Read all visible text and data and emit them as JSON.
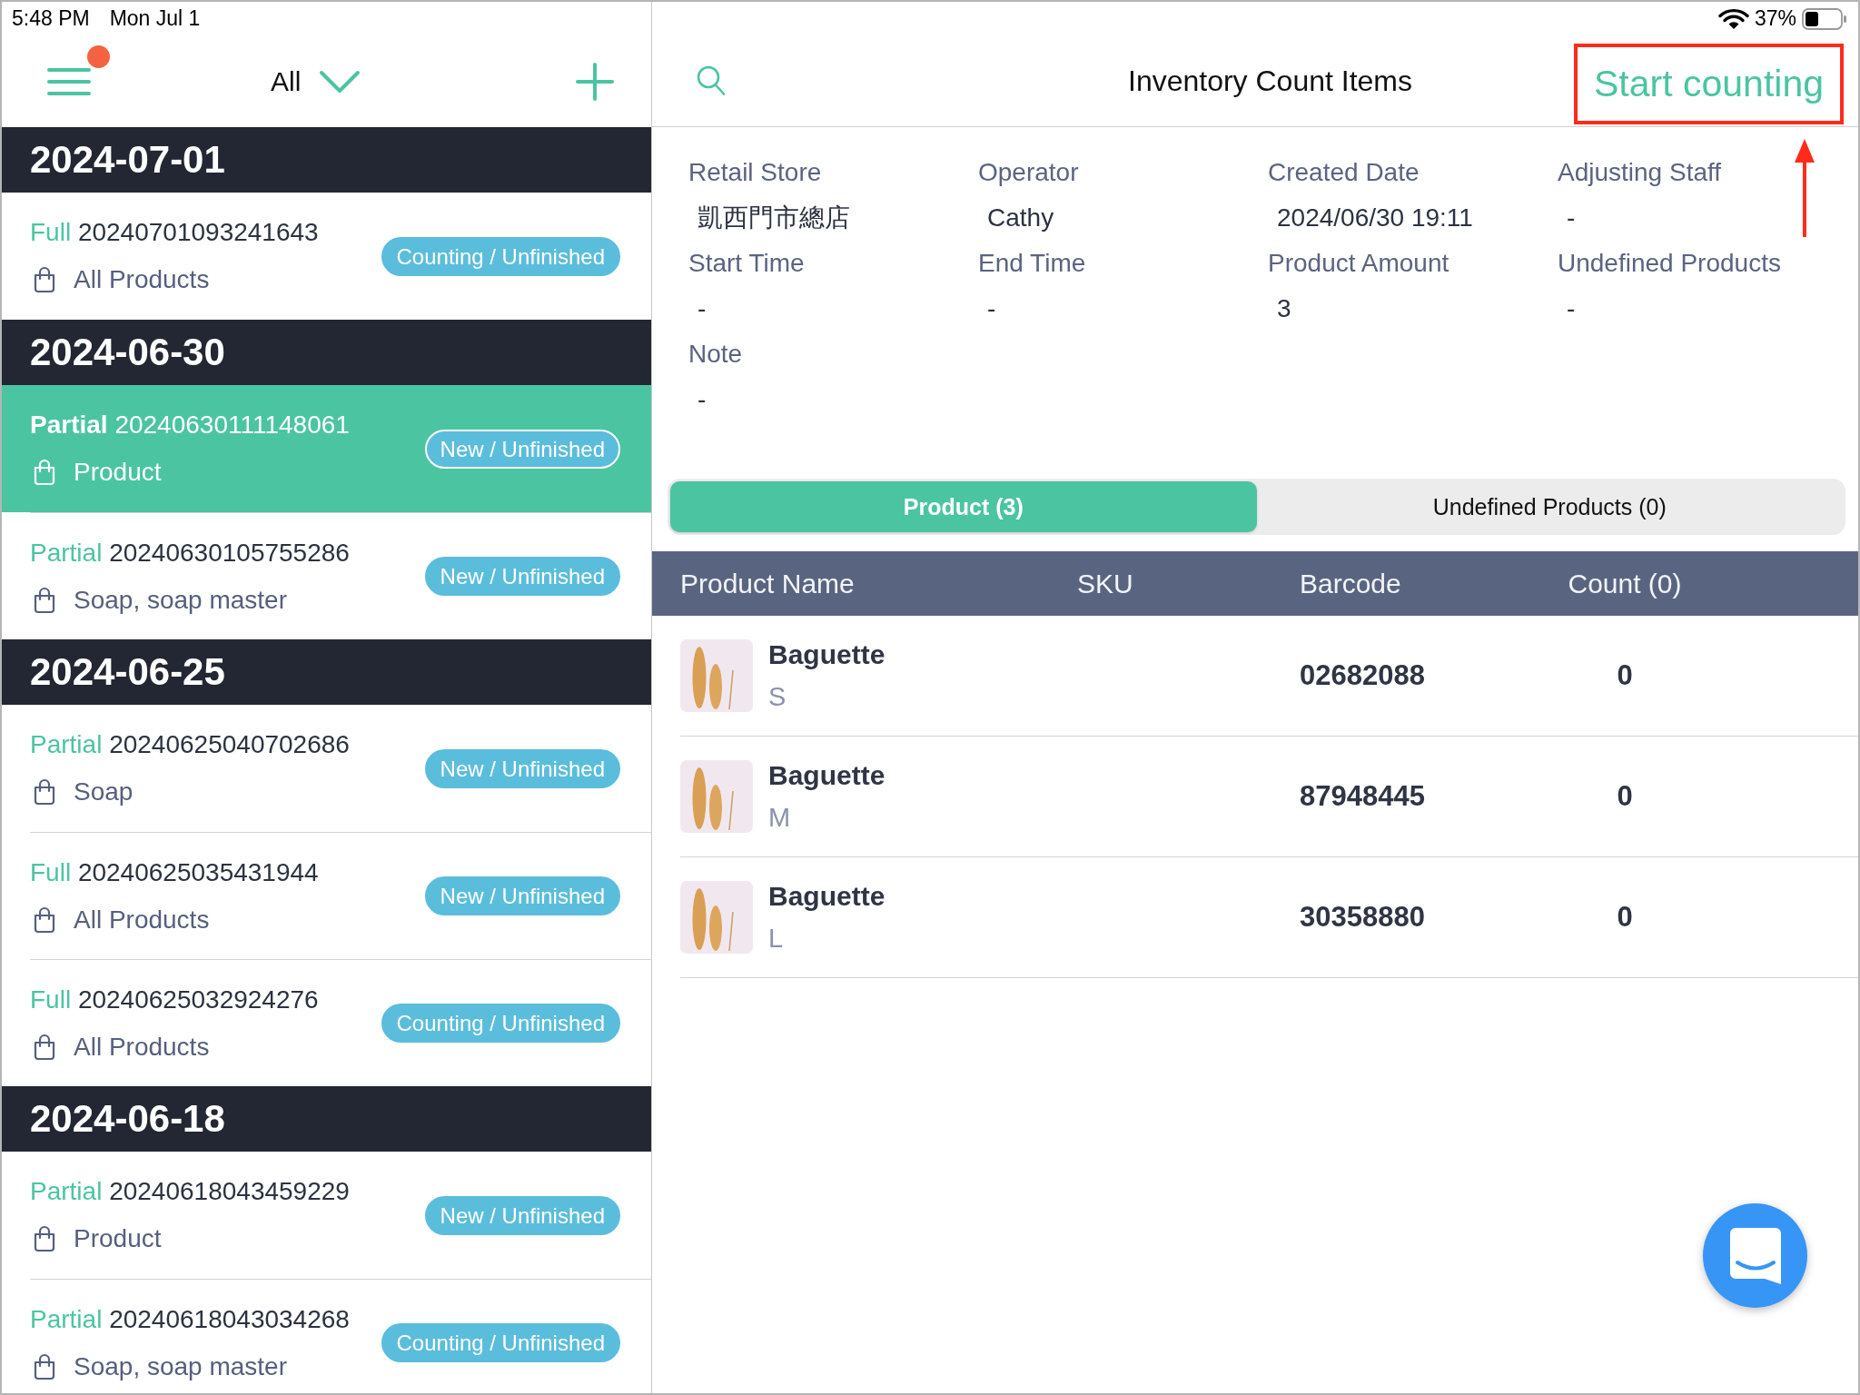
{
  "status_bar": {
    "time": "5:48 PM",
    "date": "Mon Jul 1",
    "battery": "37%"
  },
  "sidebar": {
    "menu_notification": true,
    "filter": "All",
    "groups": [
      {
        "date": "2024-07-01",
        "items": [
          {
            "type": "Full",
            "number": "20240701093241643",
            "scope": "All Products",
            "status": "Counting / Unfinished",
            "selected": false
          }
        ]
      },
      {
        "date": "2024-06-30",
        "items": [
          {
            "type": "Partial",
            "number": "20240630111148061",
            "scope": "Product",
            "status": "New / Unfinished",
            "selected": true
          },
          {
            "type": "Partial",
            "number": "20240630105755286",
            "scope": "Soap, soap master",
            "status": "New / Unfinished",
            "selected": false
          }
        ]
      },
      {
        "date": "2024-06-25",
        "items": [
          {
            "type": "Partial",
            "number": "20240625040702686",
            "scope": "Soap",
            "status": "New / Unfinished",
            "selected": false
          },
          {
            "type": "Full",
            "number": "20240625035431944",
            "scope": "All Products",
            "status": "New / Unfinished",
            "selected": false
          },
          {
            "type": "Full",
            "number": "20240625032924276",
            "scope": "All Products",
            "status": "Counting / Unfinished",
            "selected": false
          }
        ]
      },
      {
        "date": "2024-06-18",
        "items": [
          {
            "type": "Partial",
            "number": "20240618043459229",
            "scope": "Product",
            "status": "New / Unfinished",
            "selected": false
          },
          {
            "type": "Partial",
            "number": "20240618043034268",
            "scope": "Soap, soap master",
            "status": "Counting / Unfinished",
            "selected": false
          }
        ]
      }
    ]
  },
  "detail": {
    "title": "Inventory Count Items",
    "start_button": {
      "label": "Start counting",
      "highlighted": true
    },
    "fields": [
      {
        "label": "Retail Store",
        "value": "凱西門市總店"
      },
      {
        "label": "Operator",
        "value": "Cathy"
      },
      {
        "label": "Created Date",
        "value": "2024/06/30 19:11"
      },
      {
        "label": "Adjusting Staff",
        "value": "-"
      },
      {
        "label": "Start Time",
        "value": "-"
      },
      {
        "label": "End Time",
        "value": "-"
      },
      {
        "label": "Product Amount",
        "value": "3"
      },
      {
        "label": "Undefined Products",
        "value": "-"
      },
      {
        "label": "Note",
        "value": "-"
      }
    ],
    "tabs": [
      {
        "label": "Product (3)",
        "selected": true
      },
      {
        "label": "Undefined Products (0)",
        "selected": false
      }
    ],
    "table": {
      "columns": [
        "Product Name",
        "SKU",
        "Barcode",
        "Count (0)"
      ],
      "rows": [
        {
          "name": "Baguette",
          "variant": "S",
          "barcode": "02682088",
          "count": "0"
        },
        {
          "name": "Baguette",
          "variant": "M",
          "barcode": "87948445",
          "count": "0"
        },
        {
          "name": "Baguette",
          "variant": "L",
          "barcode": "30358880",
          "count": "0"
        }
      ]
    }
  }
}
